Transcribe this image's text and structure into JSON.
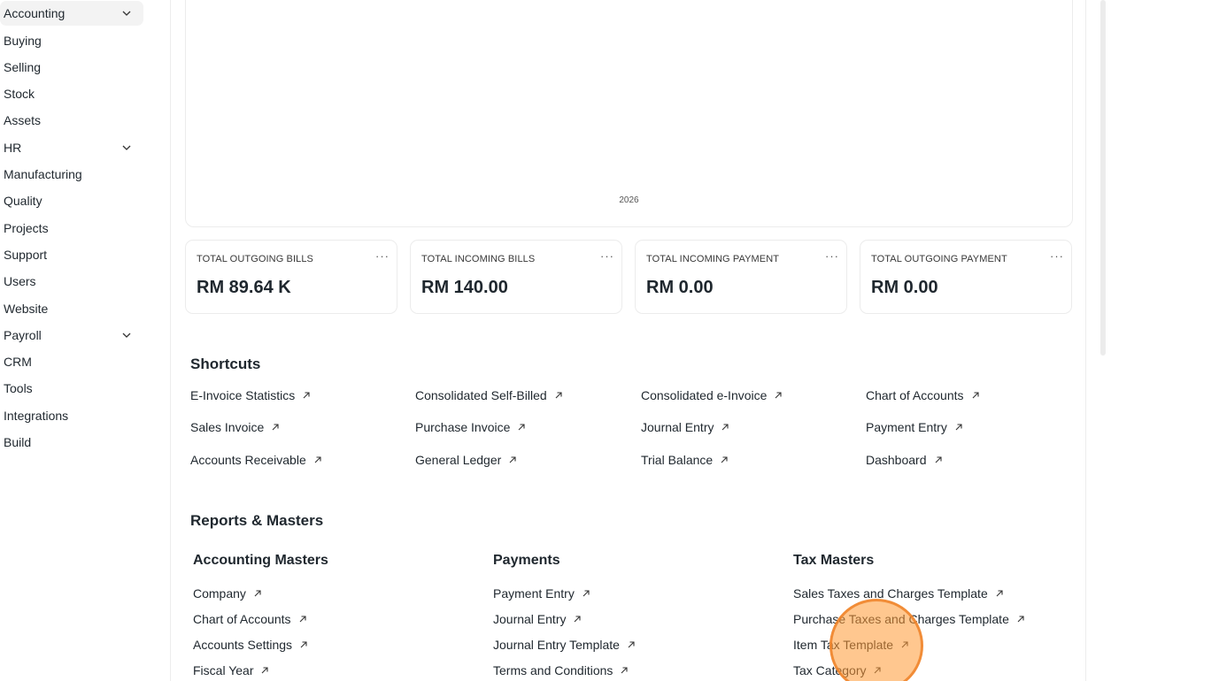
{
  "sidebar": {
    "items": [
      {
        "label": "Accounting",
        "has_children": true
      },
      {
        "label": "Buying"
      },
      {
        "label": "Selling"
      },
      {
        "label": "Stock"
      },
      {
        "label": "Assets"
      },
      {
        "label": "HR",
        "has_children": true
      },
      {
        "label": "Manufacturing"
      },
      {
        "label": "Quality"
      },
      {
        "label": "Projects"
      },
      {
        "label": "Support"
      },
      {
        "label": "Users"
      },
      {
        "label": "Website"
      },
      {
        "label": "Payroll",
        "has_children": true
      },
      {
        "label": "CRM"
      },
      {
        "label": "Tools"
      },
      {
        "label": "Integrations"
      },
      {
        "label": "Build"
      }
    ]
  },
  "chart": {
    "x_label": "2026"
  },
  "cards": [
    {
      "title": "TOTAL OUTGOING BILLS",
      "value": "RM 89.64 K",
      "menu": "···"
    },
    {
      "title": "TOTAL INCOMING BILLS",
      "value": "RM 140.00",
      "menu": "···"
    },
    {
      "title": "TOTAL INCOMING PAYMENT",
      "value": "RM 0.00",
      "menu": "···"
    },
    {
      "title": "TOTAL OUTGOING PAYMENT",
      "value": "RM 0.00",
      "menu": "···"
    }
  ],
  "shortcuts": {
    "title": "Shortcuts",
    "items": [
      "E-Invoice Statistics",
      "Consolidated Self-Billed",
      "Consolidated e-Invoice",
      "Chart of Accounts",
      "Sales Invoice",
      "Purchase Invoice",
      "Journal Entry",
      "Payment Entry",
      "Accounts Receivable",
      "General Ledger",
      "Trial Balance",
      "Dashboard"
    ]
  },
  "reports": {
    "title": "Reports & Masters",
    "groups": [
      {
        "title": "Accounting Masters",
        "items": [
          "Company",
          "Chart of Accounts",
          "Accounts Settings",
          "Fiscal Year"
        ]
      },
      {
        "title": "Payments",
        "items": [
          "Payment Entry",
          "Journal Entry",
          "Journal Entry Template",
          "Terms and Conditions"
        ]
      },
      {
        "title": "Tax Masters",
        "items": [
          "Sales Taxes and Charges Template",
          "Purchase Taxes and Charges Template",
          "Item Tax Template",
          "Tax Category"
        ]
      }
    ]
  },
  "icons": {
    "chevron": "chevron-down-icon",
    "link_arrow": "arrow-up-right-icon"
  },
  "colors": {
    "highlight": "#ff9933",
    "text": "#1f272e",
    "active_bg": "#f3f3f3"
  }
}
